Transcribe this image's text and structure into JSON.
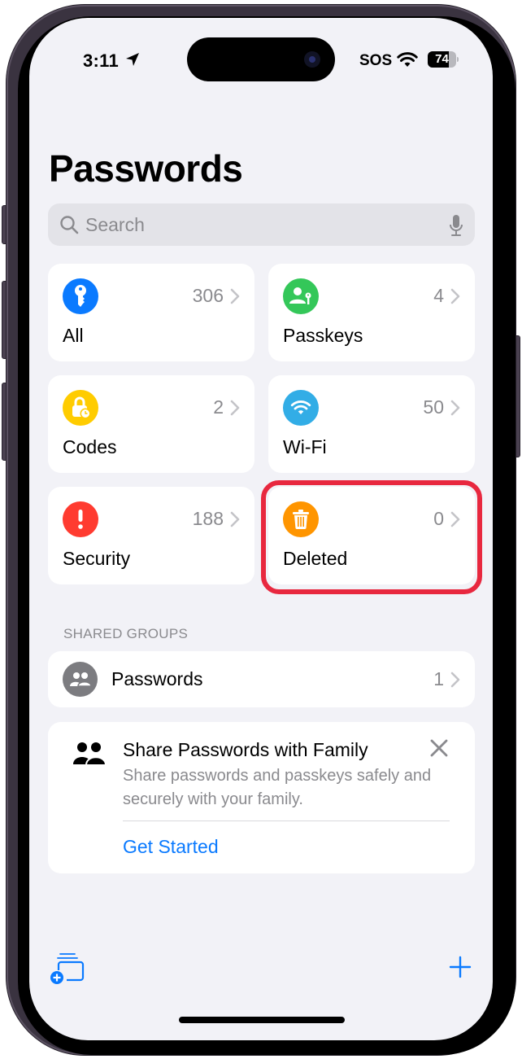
{
  "status_bar": {
    "time": "3:11",
    "carrier": "SOS",
    "battery_percent": 74,
    "battery_label": "74",
    "icons": [
      "location-arrow-icon",
      "wifi-icon",
      "battery-icon"
    ]
  },
  "header": {
    "title": "Passwords"
  },
  "search": {
    "placeholder": "Search",
    "value": ""
  },
  "categories": [
    {
      "label": "All",
      "count": "306",
      "icon": "key-icon",
      "color": "#0a7aff"
    },
    {
      "label": "Passkeys",
      "count": "4",
      "icon": "person-key-icon",
      "color": "#34c759"
    },
    {
      "label": "Codes",
      "count": "2",
      "icon": "lock-clock-icon",
      "color": "#ffcc00"
    },
    {
      "label": "Wi-Fi",
      "count": "50",
      "icon": "wifi-icon",
      "color": "#32ade6"
    },
    {
      "label": "Security",
      "count": "188",
      "icon": "exclamation-icon",
      "color": "#ff3b30"
    },
    {
      "label": "Deleted",
      "count": "0",
      "icon": "trash-icon",
      "color": "#ff9500",
      "highlighted": true
    }
  ],
  "highlight_color": "#e8283f",
  "shared_groups": {
    "header": "SHARED GROUPS",
    "items": [
      {
        "label": "Passwords",
        "count": "1",
        "icon": "people-icon"
      }
    ]
  },
  "share_card": {
    "title": "Share Passwords with Family",
    "description": "Share passwords and passkeys safely and securely with your family.",
    "cta": "Get Started",
    "icon": "people-icon"
  },
  "toolbar": {
    "left_icon": "new-group-icon",
    "right_icon": "plus-icon"
  },
  "accent_color": "#0a7aff"
}
